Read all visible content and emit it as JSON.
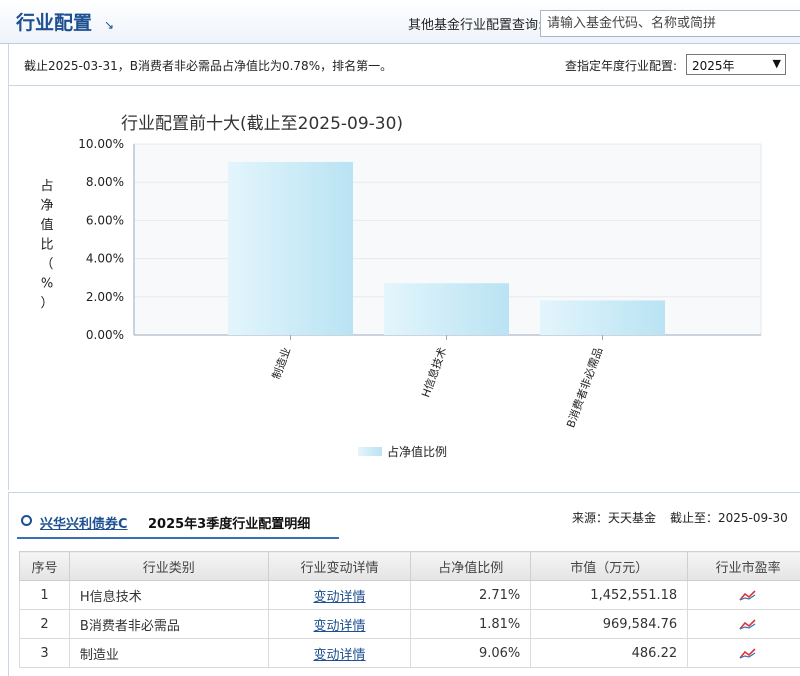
{
  "header": {
    "title": "行业配置",
    "arrow": "↘",
    "query_label": "其他基金行业配置查询:",
    "search_placeholder": "请输入基金代码、名称或简拼"
  },
  "info": {
    "text": "截止2025-03-31，B消费者非必需品占净值比为0.78%，排名第一。",
    "year_label": "查指定年度行业配置:",
    "year_value": "2025年"
  },
  "chart_data": {
    "type": "bar",
    "title": "行业配置前十大(截止至2025-09-30)",
    "ylabel": "占净值比（%）",
    "categories": [
      "制造业",
      "H信息技术",
      "B消费者非必需品"
    ],
    "values": [
      9.06,
      2.71,
      1.81
    ],
    "yticks": [
      "0.00%",
      "2.00%",
      "4.00%",
      "6.00%",
      "8.00%",
      "10.00%"
    ],
    "ylim": [
      0,
      10
    ],
    "legend": "占净值比例",
    "legend_position": "bottom",
    "grid": true,
    "bar_color": "#b9e3f3"
  },
  "detail": {
    "fund_name": "兴华兴利债券C",
    "section_title": "2025年3季度行业配置明细",
    "source": "来源：天天基金",
    "as_of": "截止至：2025-09-30",
    "columns": [
      "序号",
      "行业类别",
      "行业变动详情",
      "占净值比例",
      "市值（万元）",
      "行业市盈率"
    ],
    "rows": [
      {
        "no": "1",
        "industry": "H信息技术",
        "detail": "变动详情",
        "ratio": "2.71%",
        "value": "1,452,551.18"
      },
      {
        "no": "2",
        "industry": "B消费者非必需品",
        "detail": "变动详情",
        "ratio": "1.81%",
        "value": "969,584.76"
      },
      {
        "no": "3",
        "industry": "制造业",
        "detail": "变动详情",
        "ratio": "9.06%",
        "value": "486.22"
      }
    ],
    "pe_icon": "trend-chart-icon"
  }
}
